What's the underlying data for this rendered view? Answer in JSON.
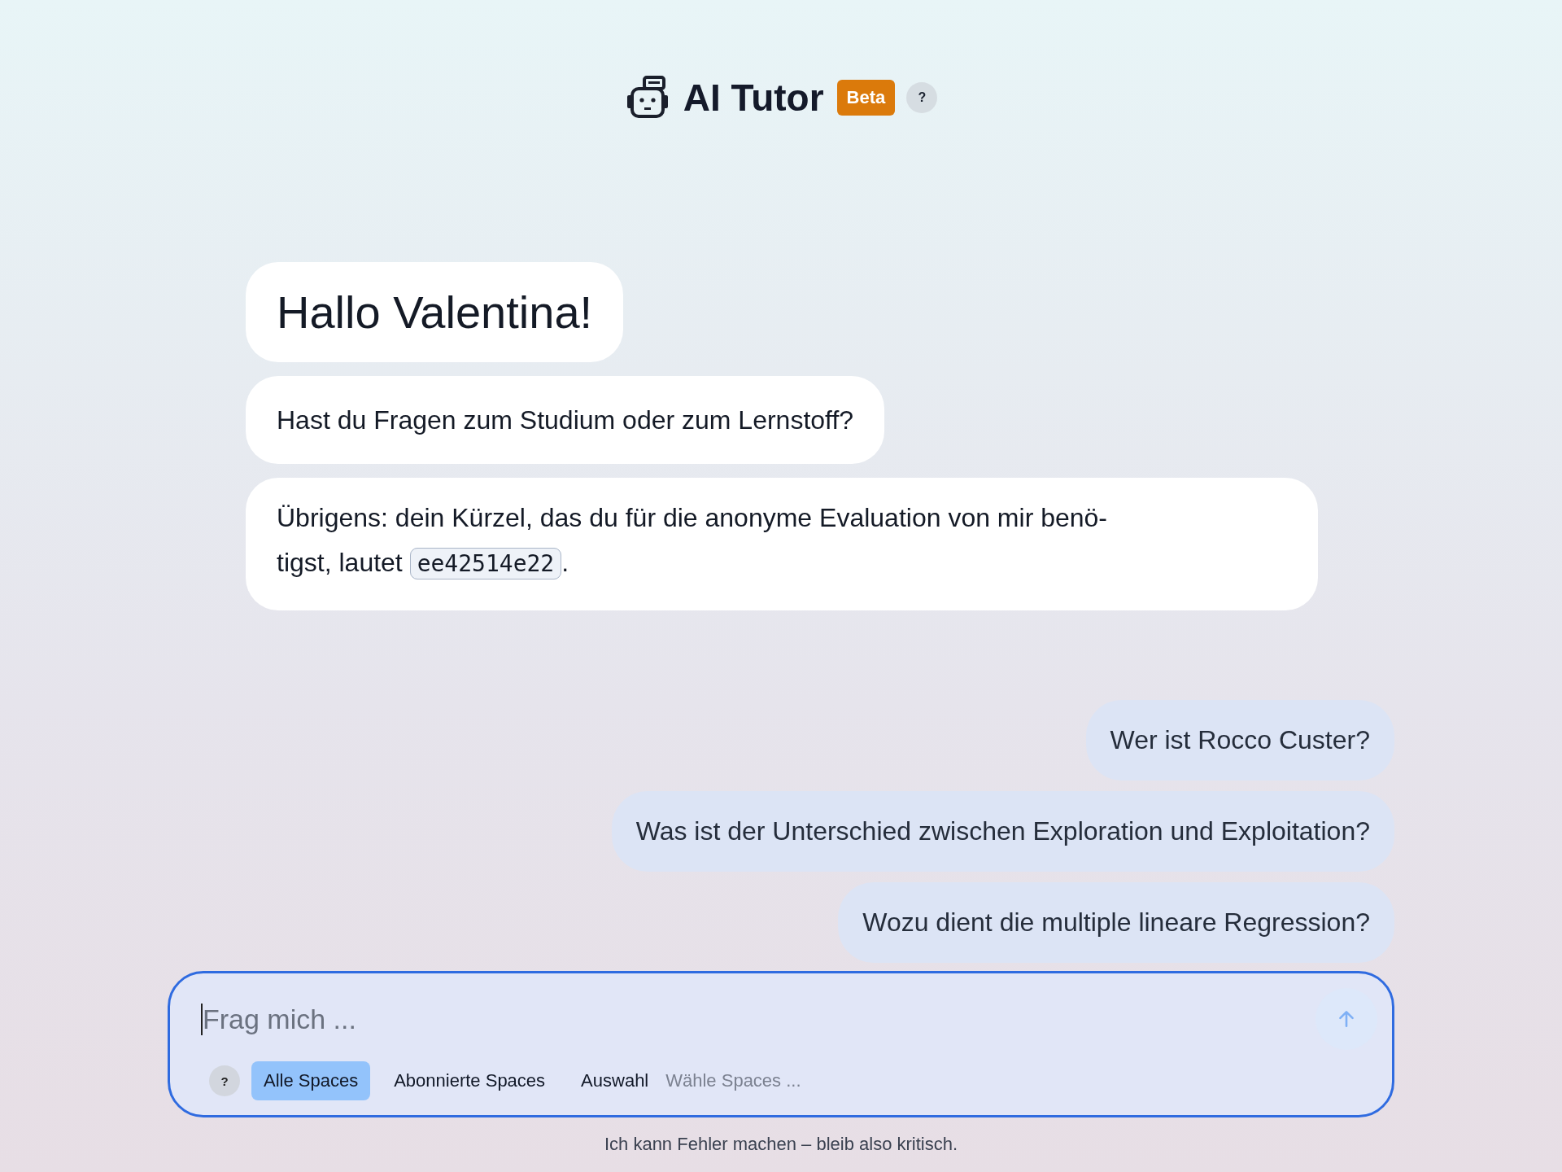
{
  "header": {
    "title": "AI Tutor",
    "badge": "Beta",
    "help": "?"
  },
  "bot_messages": [
    {
      "kind": "greeting",
      "lines": [
        "Hallo Valentina!"
      ]
    },
    {
      "kind": "text",
      "lines": [
        "Hast du Fragen zum Studium oder zum Lernstoff?"
      ]
    },
    {
      "kind": "code",
      "lines": [
        "Übrigens: dein Kürzel, das du für die anonyme Evaluation von mir benö-",
        "tigst, lautet"
      ],
      "code": "ee42514e22",
      "after": "."
    }
  ],
  "user_messages": [
    "Wer ist Rocco Custer?",
    "Was ist der Unterschied zwischen Exploration und Exploitation?",
    "Wozu dient die multiple lineare Regression?"
  ],
  "composer": {
    "placeholder": "Frag mich ...",
    "help": "?",
    "scopes": [
      {
        "label": "Alle Spaces",
        "selected": true
      },
      {
        "label": "Abonnierte Spaces",
        "selected": false
      },
      {
        "label": "Auswahl",
        "selected": false
      }
    ],
    "space_picker": {
      "placeholder": "Wähle Spaces ..."
    }
  },
  "footer": "Ich kann Fehler machen – bleib also kritisch."
}
